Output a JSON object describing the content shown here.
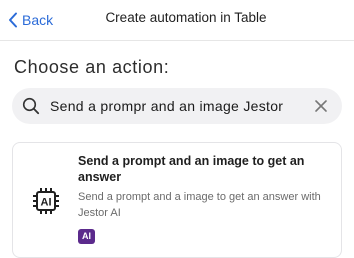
{
  "header": {
    "back_label": "Back",
    "title": "Create automation in Table"
  },
  "section_title": "Choose an action:",
  "search": {
    "value": "Send a prompr and an image Jestor"
  },
  "result_card": {
    "title": "Send a prompt and an image to get an answer",
    "description": "Send a prompt and a image to get an answer with Jestor AI",
    "badge": "AI",
    "icon": "ai-chip-icon"
  },
  "colors": {
    "accent": "#2b6bd8",
    "badge_bg": "#5b2a8c",
    "search_bg": "#f1f1f3"
  }
}
